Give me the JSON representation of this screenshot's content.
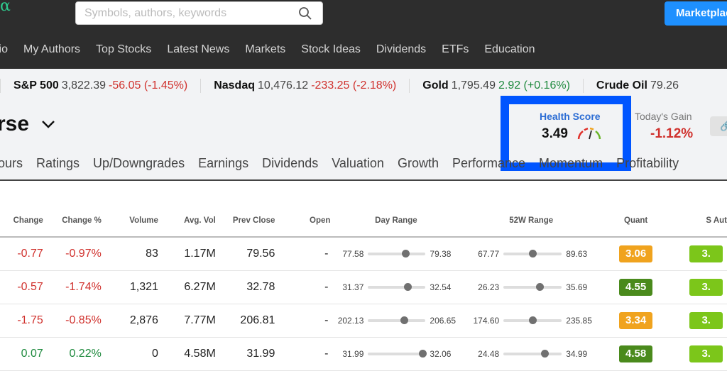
{
  "header": {
    "logo": "α",
    "search_placeholder": "Symbols, authors, keywords",
    "marketplace": "Marketplace"
  },
  "nav": [
    "lio",
    "My Authors",
    "Top Stocks",
    "Latest News",
    "Markets",
    "Stock Ideas",
    "Dividends",
    "ETFs",
    "Education"
  ],
  "ticker": [
    {
      "name": "S&P 500",
      "price": "3,822.39",
      "change": "-56.05 (-1.45%)",
      "dir": "red"
    },
    {
      "name": "Nasdaq",
      "price": "10,476.12",
      "change": "-233.25 (-2.18%)",
      "dir": "red"
    },
    {
      "name": "Gold",
      "price": "1,795.49",
      "change": "2.92 (+0.16%)",
      "dir": "green"
    },
    {
      "name": "Crude Oil",
      "price": "79.26",
      "change": "",
      "dir": "red"
    }
  ],
  "portfolio": {
    "title": "rse",
    "health_label": "Health Score",
    "health_value": "3.49",
    "gain_label": "Today's Gain",
    "gain_value": "-1.12%"
  },
  "tabs": [
    "ours",
    "Ratings",
    "Up/Downgrades",
    "Earnings",
    "Dividends",
    "Valuation",
    "Growth",
    "Performance",
    "Momentum",
    "Profitability"
  ],
  "table": {
    "headers": [
      "Change",
      "Change %",
      "Volume",
      "Avg. Vol",
      "Prev Close",
      "Open",
      "Day Range",
      "52W Range",
      "Quant",
      "S Aut"
    ],
    "rows": [
      {
        "change": "-0.77",
        "change_pct": "-0.97%",
        "dir": "red",
        "volume": "83",
        "avg_vol": "1.17M",
        "prev_close": "79.56",
        "open": "-",
        "day_low": "77.58",
        "day_high": "79.38",
        "day_pos": 0.65,
        "w_low": "67.77",
        "w_high": "89.63",
        "w_pos": 0.5,
        "quant": "3.06",
        "quant_color": "#f0a31e",
        "sa": "3.",
        "sa_color": "#7cc61a"
      },
      {
        "change": "-0.57",
        "change_pct": "-1.74%",
        "dir": "red",
        "volume": "1,321",
        "avg_vol": "6.27M",
        "prev_close": "32.78",
        "open": "-",
        "day_low": "31.37",
        "day_high": "32.54",
        "day_pos": 0.69,
        "w_low": "26.23",
        "w_high": "35.69",
        "w_pos": 0.62,
        "quant": "4.55",
        "quant_color": "#4a8a1c",
        "sa": "3.",
        "sa_color": "#7cc61a"
      },
      {
        "change": "-1.75",
        "change_pct": "-0.85%",
        "dir": "red",
        "volume": "2,876",
        "avg_vol": "7.77M",
        "prev_close": "206.81",
        "open": "-",
        "day_low": "202.13",
        "day_high": "206.65",
        "day_pos": 0.62,
        "w_low": "174.60",
        "w_high": "235.85",
        "w_pos": 0.5,
        "quant": "3.34",
        "quant_color": "#f0a31e",
        "sa": "3.",
        "sa_color": "#7cc61a"
      },
      {
        "change": "0.07",
        "change_pct": "0.22%",
        "dir": "green",
        "volume": "0",
        "avg_vol": "4.58M",
        "prev_close": "31.99",
        "open": "-",
        "day_low": "31.99",
        "day_high": "32.06",
        "day_pos": 0.95,
        "w_low": "24.48",
        "w_high": "34.99",
        "w_pos": 0.71,
        "quant": "4.58",
        "quant_color": "#4a8a1c",
        "sa": "3.",
        "sa_color": "#7cc61a"
      }
    ]
  }
}
